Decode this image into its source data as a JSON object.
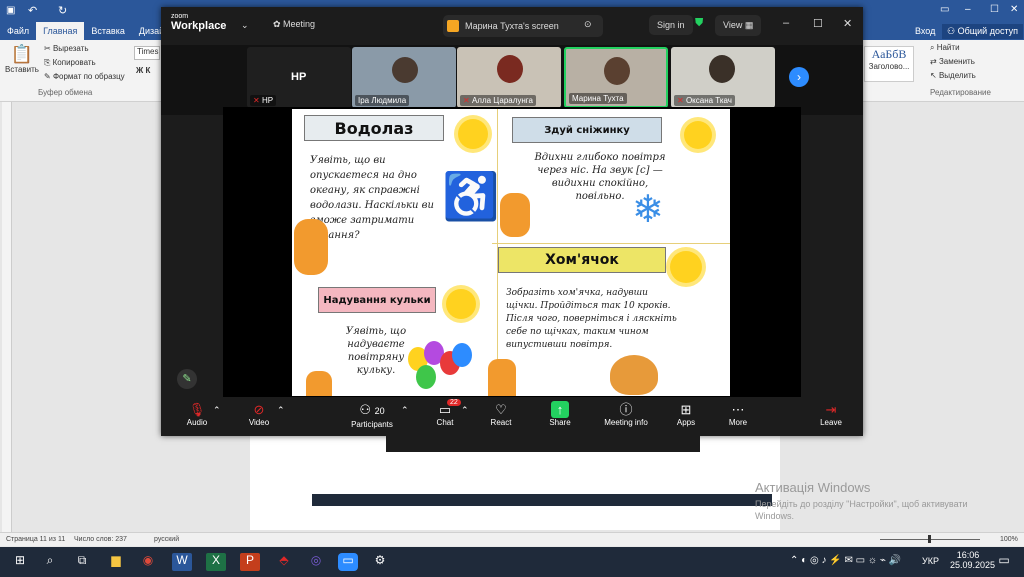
{
  "word": {
    "tabs": [
      "Файл",
      "Главная",
      "Вставка",
      "Дизай"
    ],
    "selected_tab": "Главная",
    "signin": "Вход",
    "share": "Общий доступ",
    "clipboard": {
      "paste": "Вставить",
      "cut": "Вырезать",
      "copy": "Копировать",
      "format": "Формат по образцу",
      "group": "Буфер обмена"
    },
    "font_name": "Times",
    "font_styles": "Ж К",
    "styles": {
      "sample": "АаБбВ",
      "name": "Заголово..."
    },
    "editing": {
      "find": "Найти",
      "replace": "Заменить",
      "select": "Выделить",
      "group": "Редактирование"
    },
    "status": {
      "page": "Страница 11 из 11",
      "words": "Число слов: 237",
      "lang": "русский",
      "zoom": "100%"
    },
    "activation": {
      "title": "Активація Windows",
      "sub": "Перейдіть до розділу \"Настройки\", щоб активувати",
      "sub2": "Windows."
    }
  },
  "zoom": {
    "logo_small": "zoom",
    "logo": "Workplace",
    "meeting": "Meeting",
    "screen_label": "Марина Тухта's screen",
    "signin": "Sign in",
    "view": "View",
    "participants_tiles": [
      {
        "name": "HP",
        "label": "HP"
      },
      {
        "name": "Іра Людмила"
      },
      {
        "name": "Алла Царалунга"
      },
      {
        "name": "Марина Тухта"
      },
      {
        "name": "Оксана Ткач"
      }
    ],
    "toolbar": {
      "audio": "Audio",
      "video": "Video",
      "participants": "Participants",
      "participants_count": "20",
      "chat": "Chat",
      "chat_badge": "22",
      "react": "React",
      "share": "Share",
      "info": "Meeting info",
      "apps": "Apps",
      "more": "More",
      "leave": "Leave"
    }
  },
  "slide": {
    "s1_title": "Водолаз",
    "s1_text": "Уявіть, що ви опускаєтеся на дно океану, як справжні водолази. Наскільки ви зможе затримати дихання?",
    "s2_title": "Здуй сніжинку",
    "s2_text": "Вдихни глибоко повітря через ніс. На звук [с] — видихни спокійно, повільно.",
    "s3_title": "Надування кульки",
    "s3_text": "Уявіть, що надуваєте повітряну кульку.",
    "s4_title": "Хом'ячок",
    "s4_text": "Зобразіть хом'ячка, надувши щічки. Пройдіться так 10 кроків. Після чого, поверніться і ляскніть себе по щічках, таким чином випустивши повітря."
  },
  "taskbar": {
    "time": "16:06",
    "date": "25.09.2025",
    "lang": "УКР"
  },
  "colors": {
    "word_blue": "#2b579a",
    "zoom_green": "#23d160",
    "leave_red": "#e02828"
  }
}
